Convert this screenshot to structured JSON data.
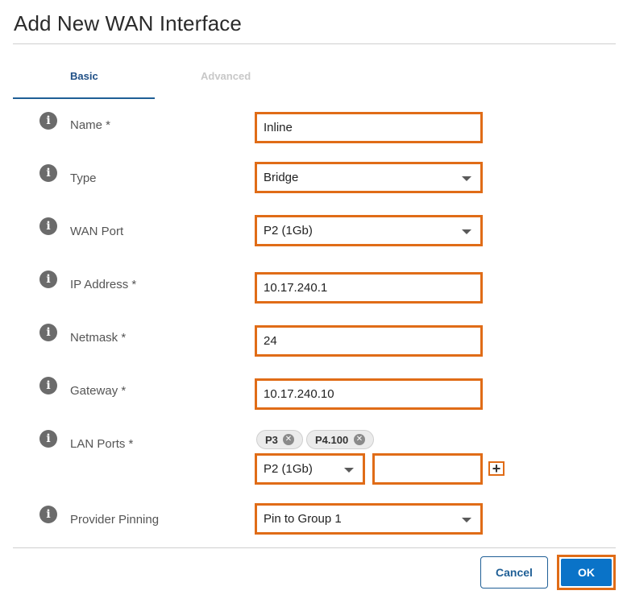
{
  "dialog": {
    "title": "Add New WAN Interface"
  },
  "tabs": [
    {
      "label": "Basic",
      "active": true
    },
    {
      "label": "Advanced",
      "active": false
    }
  ],
  "fields": {
    "name": {
      "label": "Name *",
      "value": "Inline"
    },
    "type": {
      "label": "Type",
      "value": "Bridge"
    },
    "wan_port": {
      "label": "WAN Port",
      "value": "P2 (1Gb)"
    },
    "ip_address": {
      "label": "IP Address *",
      "value": "10.17.240.1"
    },
    "netmask": {
      "label": "Netmask *",
      "value": "24"
    },
    "gateway": {
      "label": "Gateway *",
      "value": "10.17.240.10"
    },
    "lan_ports": {
      "label": "LAN Ports *",
      "chips": [
        "P3",
        "P4.100"
      ],
      "select_value": "P2 (1Gb)",
      "vlan_value": ""
    },
    "provider_pinning": {
      "label": "Provider Pinning",
      "value": "Pin to Group 1"
    }
  },
  "buttons": {
    "cancel": "Cancel",
    "ok": "OK"
  },
  "colors": {
    "highlight": "#e06c17",
    "primary": "#0a73c8",
    "tab_active": "#1f5f96"
  },
  "icons": {
    "info": "info-icon",
    "dropdown": "chevron-down-icon",
    "remove": "close-icon",
    "add": "plus-icon"
  }
}
